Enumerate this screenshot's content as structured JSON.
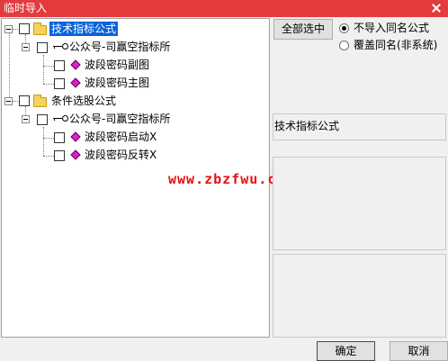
{
  "window": {
    "title": "临时导入"
  },
  "tree": {
    "groups": [
      {
        "label": "技术指标公式",
        "selected": true,
        "author": "公众号-司赢空指标所",
        "items": [
          "波段密码副图",
          "波段密码主图"
        ]
      },
      {
        "label": "条件选股公式",
        "selected": false,
        "author": "公众号-司赢空指标所",
        "items": [
          "波段密码启动X",
          "波段密码反转X"
        ]
      }
    ]
  },
  "watermark": "www.zbzfwu.com",
  "options": {
    "select_all_label": "全部选中",
    "radio_no_import": "不导入同名公式",
    "radio_overwrite": "覆盖同名(非系统)",
    "selected_radio": "radio_no_import"
  },
  "info_panel": {
    "text": "技术指标公式"
  },
  "footer": {
    "ok_label": "确定",
    "cancel_label": "取消"
  },
  "colors": {
    "titlebar": "#e43b3f",
    "selection": "#0a64d8",
    "watermark": "#e61010",
    "formula_icon": "#e020c8"
  }
}
